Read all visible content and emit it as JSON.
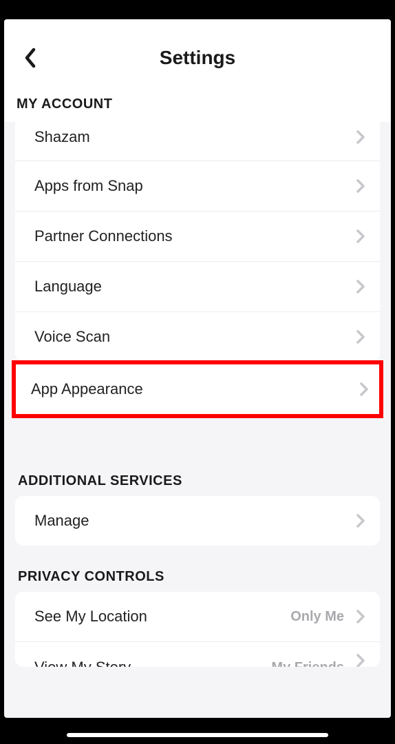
{
  "header": {
    "title": "Settings"
  },
  "sections": {
    "myAccount": {
      "title": "MY ACCOUNT",
      "items": [
        {
          "label": "Shazam"
        },
        {
          "label": "Apps from Snap"
        },
        {
          "label": "Partner Connections"
        },
        {
          "label": "Language"
        },
        {
          "label": "Voice Scan"
        },
        {
          "label": "App Appearance"
        }
      ]
    },
    "additionalServices": {
      "title": "ADDITIONAL SERVICES",
      "items": [
        {
          "label": "Manage"
        }
      ]
    },
    "privacyControls": {
      "title": "PRIVACY CONTROLS",
      "items": [
        {
          "label": "See My Location",
          "value": "Only Me"
        },
        {
          "label": "View My Story",
          "value": "My Friends"
        }
      ]
    }
  }
}
